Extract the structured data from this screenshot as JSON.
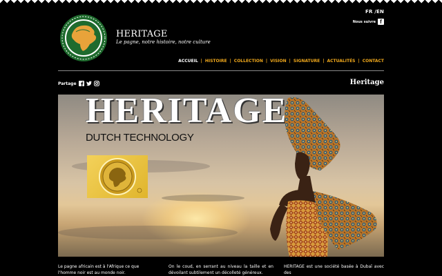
{
  "header": {
    "lang_fr": "FR",
    "lang_en": "/EN",
    "follow_label": "Nous suivre",
    "brand_title": "HERITAGE",
    "brand_tagline": "Le pagne, notre histoire, notre culture"
  },
  "nav": {
    "items": [
      "ACCUEIL",
      "HISTOIRE",
      "COLLECTION",
      "VISION",
      "SIGNATURE",
      "ACTUALITÉS",
      "CONTACT"
    ],
    "active": "ACCUEIL"
  },
  "subheader": {
    "share_label": "Partage",
    "page_heading": "Heritage"
  },
  "hero": {
    "title": "HERITAGE",
    "subtitle": "DUTCH TECHNOLOGY"
  },
  "intro": {
    "col1": "Le pagne africain est à l'Afrique ce que l'homme noir est au monde noir.",
    "col2": "On le coud, en serrant au niveau la taille et en dévoilant subtilement un décolleté généreux.",
    "col3": "HERITAGE est une société basée à Dubaï avec des"
  },
  "colors": {
    "accent": "#f0a81c",
    "background": "#000000",
    "logo_green": "#1f6b2e",
    "logo_gold": "#e8a33a"
  },
  "icons": {
    "facebook": "facebook-icon",
    "twitter": "twitter-icon",
    "instagram": "instagram-icon"
  }
}
